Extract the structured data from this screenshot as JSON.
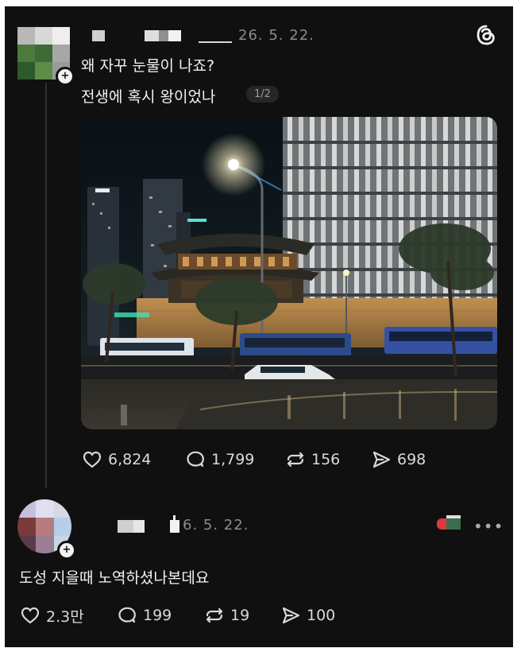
{
  "post": {
    "date": "26. 5. 22.",
    "line1": "왜 자꾸 눈물이 나죠?",
    "line2": "전생에 혹시 왕이었나",
    "page_indicator": "1/2",
    "stats": {
      "likes": "6,824",
      "comments": "1,799",
      "reposts": "156",
      "shares": "698"
    }
  },
  "reply": {
    "date": "6. 5. 22.",
    "text": "도성 지을때 노역하셨나본데요",
    "stats": {
      "likes": "2.3만",
      "comments": "199",
      "reposts": "19",
      "shares": "100"
    }
  },
  "icons": {
    "app": "threads-icon",
    "like": "heart-icon",
    "comment": "comment-bubble-icon",
    "repost": "repost-icon",
    "share": "send-icon",
    "more": "more-dots-icon"
  },
  "colors": {
    "background": "#101010",
    "text": "#f2f2f2",
    "muted": "#8c8c8c",
    "badge": "#262626"
  }
}
